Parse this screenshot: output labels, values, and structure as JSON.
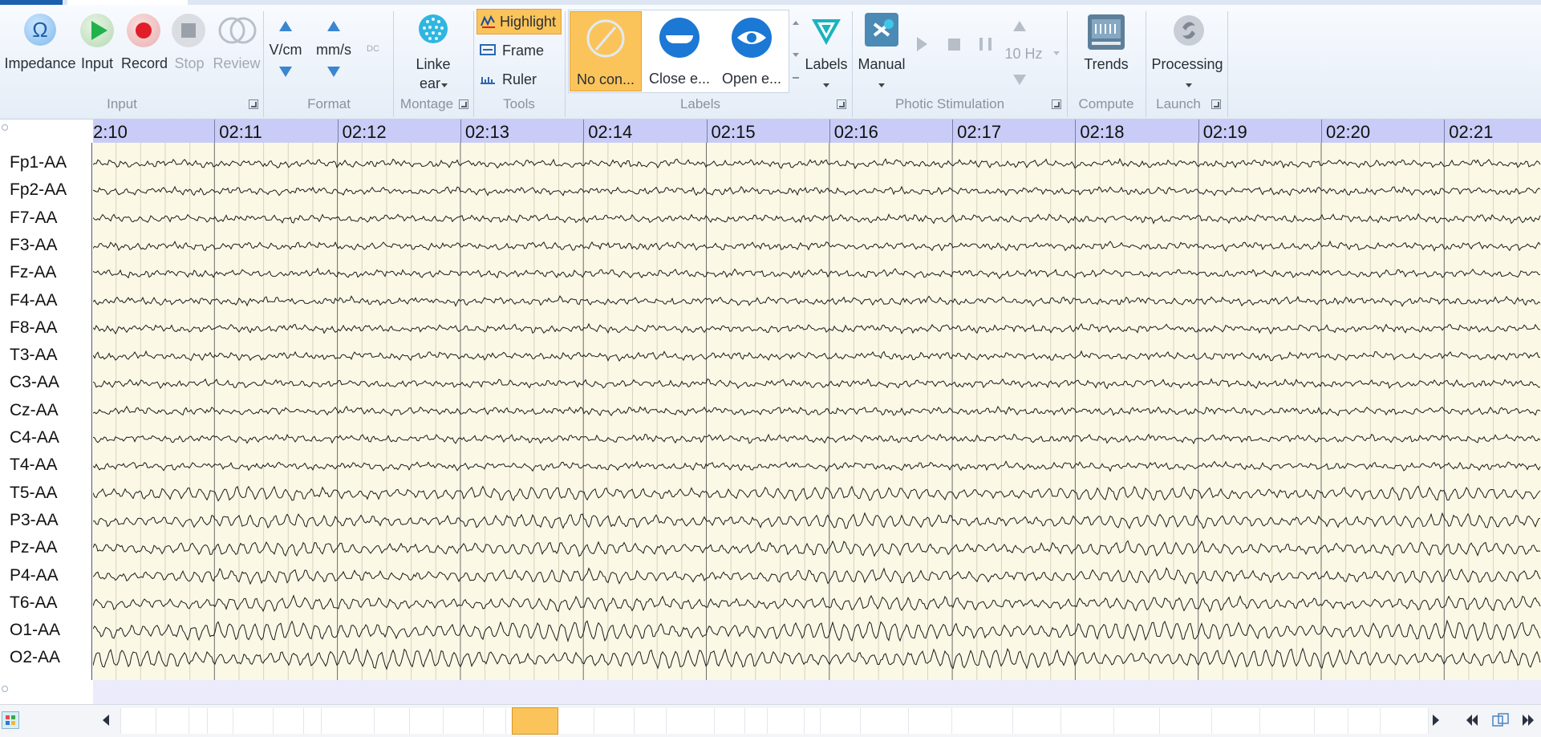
{
  "ribbon": {
    "input": {
      "group_label": "Input",
      "impedance_label": "Impedance",
      "input_label": "Input",
      "record_label": "Record",
      "stop_label": "Stop",
      "review_label": "Review"
    },
    "format": {
      "group_label": "Format",
      "sensitivity_label": "V/cm",
      "speed_label": "mm/s",
      "dc_label": "DC"
    },
    "montage": {
      "group_label": "Montage",
      "button_label_line1": "Linke",
      "button_label_line2": "ear"
    },
    "tools": {
      "group_label": "Tools",
      "highlight_label": "Highlight",
      "frame_label": "Frame",
      "ruler_label": "Ruler"
    },
    "labels": {
      "group_label": "Labels",
      "gallery": [
        {
          "label": "No con...",
          "icon": "no-condition-icon"
        },
        {
          "label": "Close e...",
          "icon": "eyes-closed-icon"
        },
        {
          "label": "Open e...",
          "icon": "eyes-open-icon"
        }
      ],
      "labels_button": "Labels"
    },
    "photic": {
      "group_label": "Photic Stimulation",
      "manual_label": "Manual",
      "frequency": "10 Hz"
    },
    "compute": {
      "group_label": "Compute",
      "trends_label": "Trends"
    },
    "launch": {
      "group_label": "Launch",
      "processing_label": "Processing"
    }
  },
  "timeline": {
    "ticks": [
      "2:10",
      "02:11",
      "02:12",
      "02:13",
      "02:14",
      "02:15",
      "02:16",
      "02:17",
      "02:18",
      "02:19",
      "02:20",
      "02:21"
    ]
  },
  "channels": [
    "Fp1-AA",
    "Fp2-AA",
    "F7-AA",
    "F3-AA",
    "Fz-AA",
    "F4-AA",
    "F8-AA",
    "T3-AA",
    "C3-AA",
    "Cz-AA",
    "C4-AA",
    "T4-AA",
    "T5-AA",
    "P3-AA",
    "Pz-AA",
    "P4-AA",
    "T6-AA",
    "O1-AA",
    "O2-AA"
  ],
  "colors": {
    "eeg_background": "#fbf8e6",
    "time_bar": "#c9ccf6",
    "highlight_active": "#fbc45a",
    "record_red": "#e11d2a",
    "input_green": "#22b24c",
    "accent_blue": "#1b78d4"
  }
}
